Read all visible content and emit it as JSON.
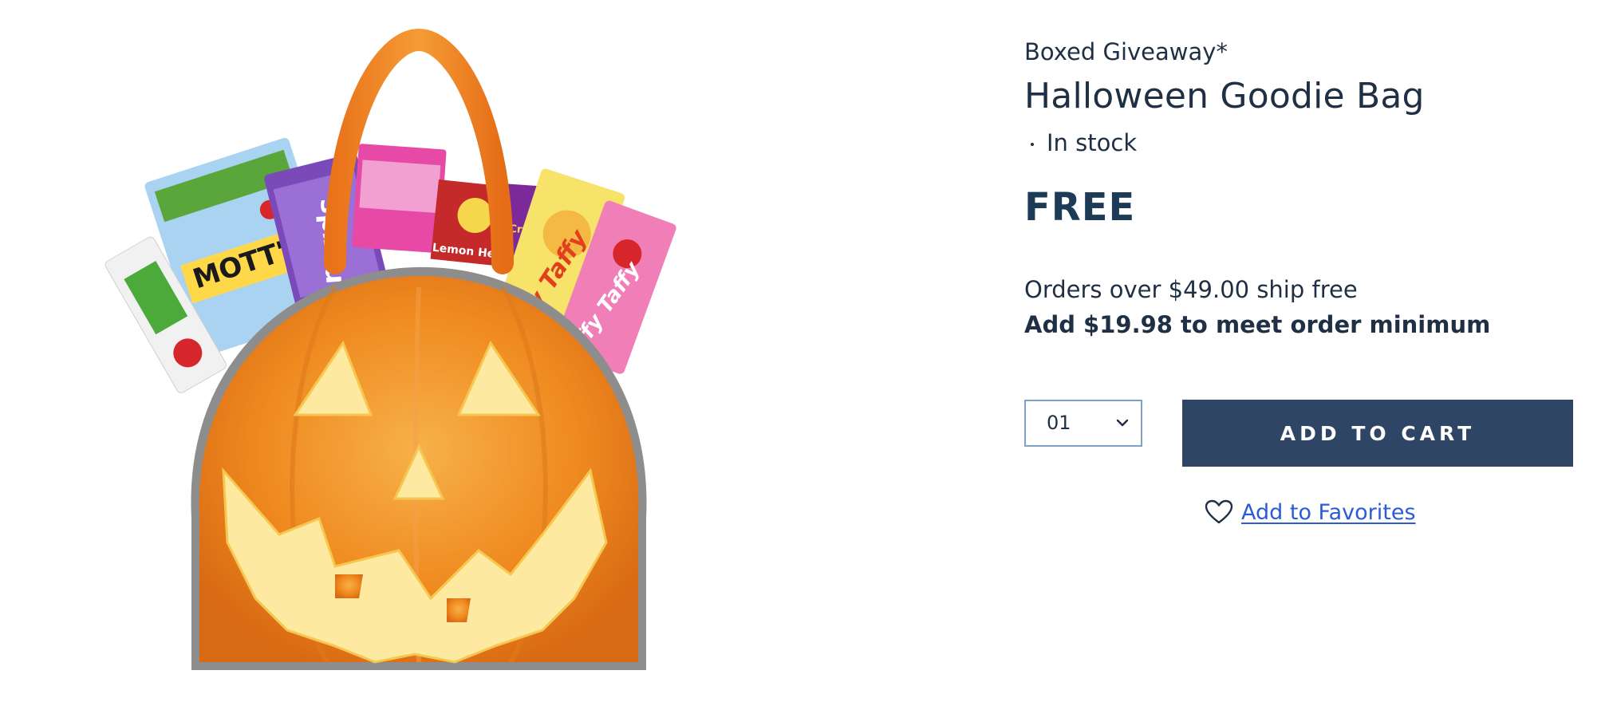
{
  "product": {
    "brand": "Boxed Giveaway*",
    "title": "Halloween Goodie Bag",
    "stock_status": "In stock",
    "price": "FREE"
  },
  "shipping": {
    "threshold_text": "Orders over $49.00 ship free",
    "minimum_text": "Add $19.98 to meet order minimum"
  },
  "purchase": {
    "quantity_value": "01",
    "add_to_cart_label": "ADD TO CART",
    "favorites_label": "Add to Favorites"
  },
  "image": {
    "candy_labels": [
      "MOTT'S",
      "nerds",
      "Laffy Taffy",
      "Laffy Taffy",
      "Lemon Head",
      "Cry Baby"
    ]
  },
  "colors": {
    "navy_text": "#1f2f44",
    "price_color": "#1d3a57",
    "button_bg": "#2e4566",
    "link_blue": "#2b5cd6",
    "select_border": "#7ea0c2",
    "pumpkin_orange": "#ef8a1f",
    "pumpkin_face": "#fde9a0"
  }
}
